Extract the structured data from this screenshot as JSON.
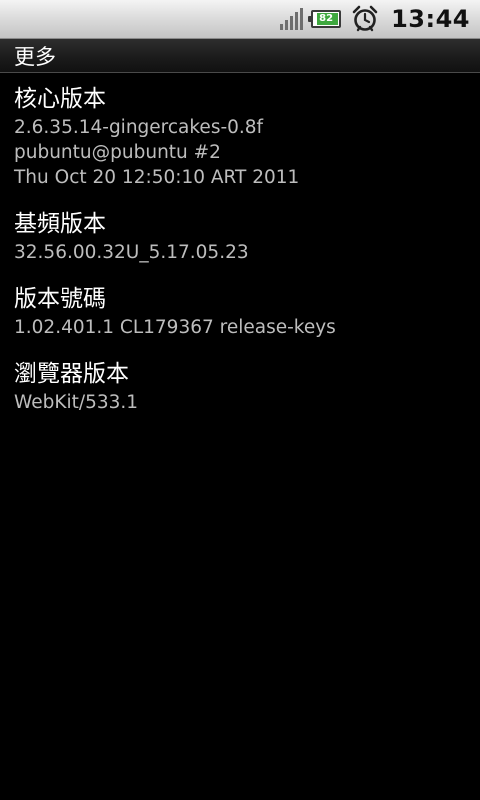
{
  "status_bar": {
    "battery_level": "82",
    "time": "13:44",
    "icons": [
      "signal-icon",
      "battery-icon",
      "alarm-clock-icon"
    ]
  },
  "title_bar": {
    "title": "更多"
  },
  "items": [
    {
      "label": "核心版本",
      "value_lines": [
        "2.6.35.14-gingercakes-0.8f",
        "pubuntu@pubuntu #2",
        "Thu Oct 20 12:50:10 ART 2011"
      ]
    },
    {
      "label": "基頻版本",
      "value_lines": [
        "32.56.00.32U_5.17.05.23"
      ]
    },
    {
      "label": "版本號碼",
      "value_lines": [
        "1.02.401.1 CL179367 release-keys"
      ]
    },
    {
      "label": "瀏覽器版本",
      "value_lines": [
        "WebKit/533.1"
      ]
    }
  ]
}
